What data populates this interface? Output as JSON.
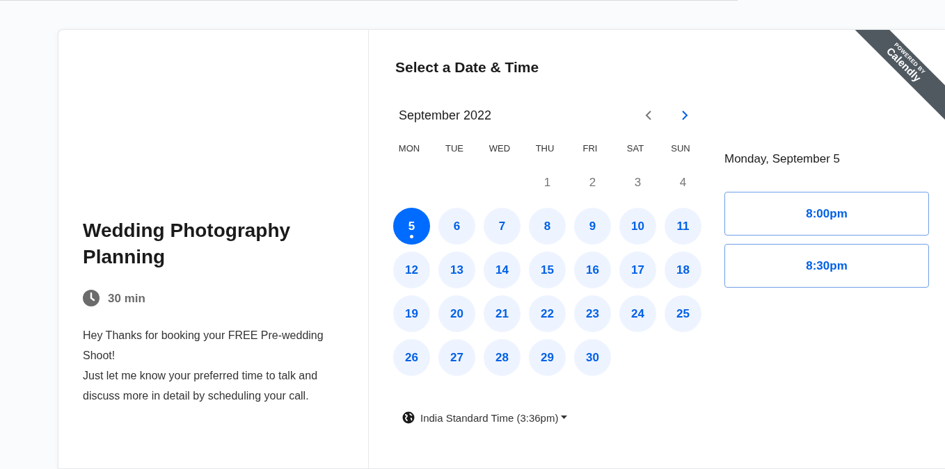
{
  "event": {
    "title": "Wedding Photography Planning",
    "duration": "30 min",
    "description": [
      "Hey Thanks for booking your FREE Pre-wedding Shoot!",
      "Just let me know your preferred time to talk and discuss more in detail by scheduling your call."
    ]
  },
  "ribbon": {
    "line_1": "POWERED BY",
    "line_2": "Calendly"
  },
  "heading": "Select a Date & Time",
  "calendar": {
    "month": "September 2022",
    "prev": {
      "disabled": true
    },
    "next": {
      "disabled": false
    },
    "weekdays": [
      "MON",
      "TUE",
      "WED",
      "THU",
      "FRI",
      "SAT",
      "SUN"
    ],
    "weeks": [
      [
        {
          "label": "1",
          "available": false,
          "selected": false
        },
        {
          "label": "2",
          "available": false,
          "selected": false
        },
        {
          "label": "3",
          "available": false,
          "selected": false
        },
        {
          "label": "4",
          "available": false,
          "selected": false
        }
      ],
      [
        {
          "label": "5",
          "available": true,
          "selected": true
        },
        {
          "label": "6",
          "available": true,
          "selected": false
        },
        {
          "label": "7",
          "available": true,
          "selected": false
        },
        {
          "label": "8",
          "available": true,
          "selected": false
        },
        {
          "label": "9",
          "available": true,
          "selected": false
        },
        {
          "label": "10",
          "available": true,
          "selected": false
        },
        {
          "label": "11",
          "available": true,
          "selected": false
        }
      ],
      [
        {
          "label": "12",
          "available": true,
          "selected": false
        },
        {
          "label": "13",
          "available": true,
          "selected": false
        },
        {
          "label": "14",
          "available": true,
          "selected": false
        },
        {
          "label": "15",
          "available": true,
          "selected": false
        },
        {
          "label": "16",
          "available": true,
          "selected": false
        },
        {
          "label": "17",
          "available": true,
          "selected": false
        },
        {
          "label": "18",
          "available": true,
          "selected": false
        }
      ],
      [
        {
          "label": "19",
          "available": true,
          "selected": false
        },
        {
          "label": "20",
          "available": true,
          "selected": false
        },
        {
          "label": "21",
          "available": true,
          "selected": false
        },
        {
          "label": "22",
          "available": true,
          "selected": false
        },
        {
          "label": "23",
          "available": true,
          "selected": false
        },
        {
          "label": "24",
          "available": true,
          "selected": false
        },
        {
          "label": "25",
          "available": true,
          "selected": false
        }
      ],
      [
        {
          "label": "26",
          "available": true,
          "selected": false
        },
        {
          "label": "27",
          "available": true,
          "selected": false
        },
        {
          "label": "28",
          "available": true,
          "selected": false
        },
        {
          "label": "29",
          "available": true,
          "selected": false
        },
        {
          "label": "30",
          "available": true,
          "selected": false
        }
      ]
    ]
  },
  "timezone": "India Standard Time (3:36pm)",
  "selected_date": "Monday, September 5",
  "times": [
    "8:00pm",
    "8:30pm"
  ]
}
